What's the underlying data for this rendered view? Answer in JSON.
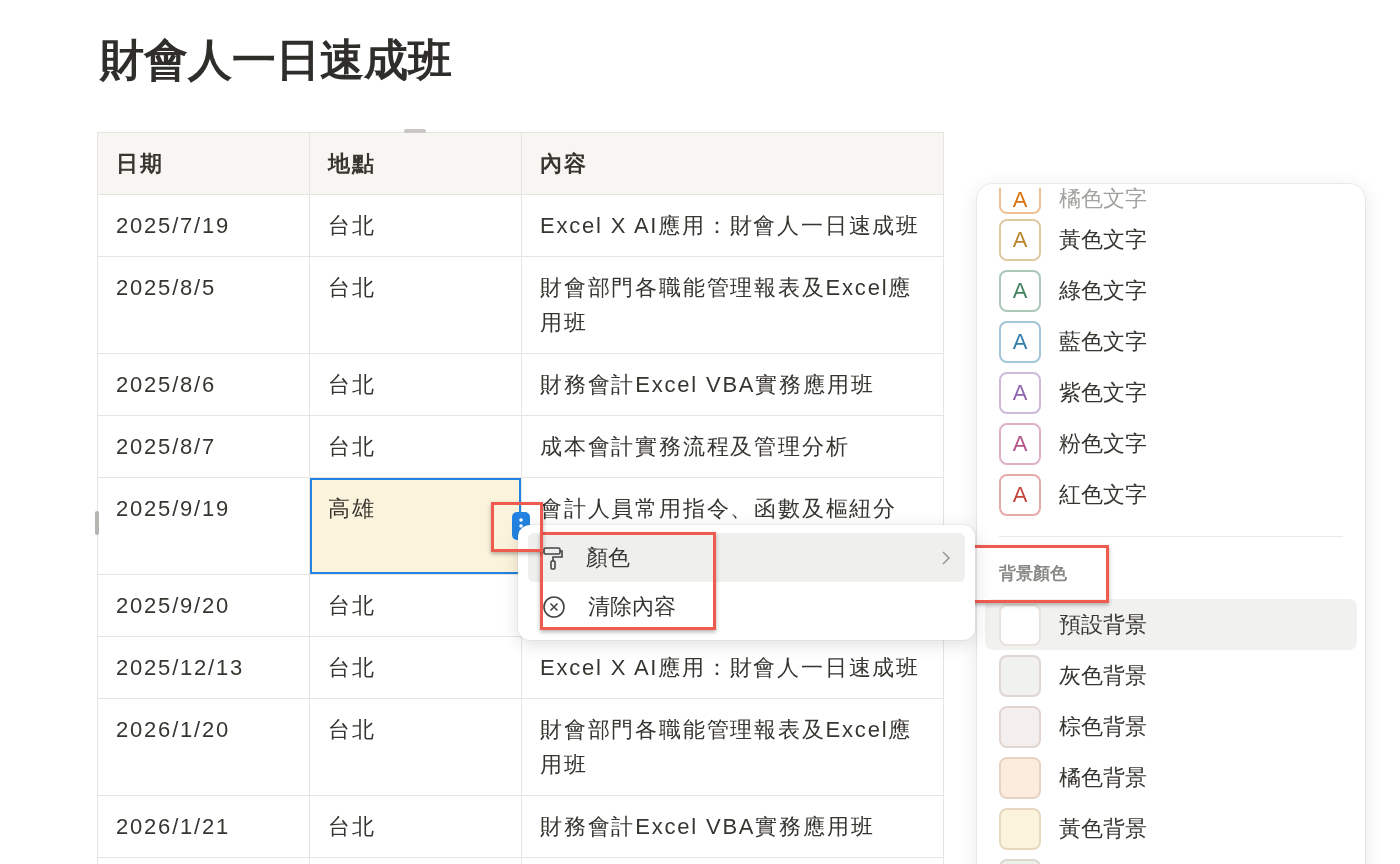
{
  "title": "財會人一日速成班",
  "table": {
    "columns": [
      "日期",
      "地點",
      "內容"
    ],
    "rows": [
      {
        "date": "2025/7/19",
        "place": "台北",
        "content": "Excel X AI應用：財會人一日速成班",
        "selected": false
      },
      {
        "date": "2025/8/5",
        "place": "台北",
        "content": "財會部門各職能管理報表及Excel應用班",
        "selected": false
      },
      {
        "date": "2025/8/6",
        "place": "台北",
        "content": "財務會計Excel VBA實務應用班",
        "selected": false
      },
      {
        "date": "2025/8/7",
        "place": "台北",
        "content": "成本會計實務流程及管理分析",
        "selected": false
      },
      {
        "date": "2025/9/19",
        "place": "高雄",
        "content": "會計人員常用指令、函數及樞紐分",
        "selected": true
      },
      {
        "date": "2025/9/20",
        "place": "台北",
        "selected": false
      },
      {
        "date": "2025/12/13",
        "place": "台北",
        "content": "Excel X AI應用：財會人一日速成班",
        "selected": false
      },
      {
        "date": "2026/1/20",
        "place": "台北",
        "content": "財會部門各職能管理報表及Excel應用班",
        "selected": false
      },
      {
        "date": "2026/1/21",
        "place": "台北",
        "content": "財務會計Excel VBA實務應用班",
        "selected": false
      },
      {
        "selected": false
      }
    ]
  },
  "cell_handle": {
    "highlighted": true
  },
  "cell_menu": {
    "highlighted": true,
    "items": [
      {
        "kind": "submenu",
        "label": "顏色",
        "hovered": true
      },
      {
        "kind": "clear",
        "label": "清除內容",
        "hovered": false
      }
    ]
  },
  "color_panel": {
    "text_colors": [
      {
        "glyph": "A",
        "label": "橘色文字",
        "color": "#d9730d",
        "faded": true
      },
      {
        "glyph": "A",
        "label": "黃色文字",
        "color": "#b8872e",
        "faded": false
      },
      {
        "glyph": "A",
        "label": "綠色文字",
        "color": "#448361",
        "faded": false
      },
      {
        "glyph": "A",
        "label": "藍色文字",
        "color": "#337ea9",
        "faded": false
      },
      {
        "glyph": "A",
        "label": "紫色文字",
        "color": "#9065b0",
        "faded": false
      },
      {
        "glyph": "A",
        "label": "粉色文字",
        "color": "#b35488",
        "faded": false
      },
      {
        "glyph": "A",
        "label": "紅色文字",
        "color": "#c4463f",
        "faded": false
      }
    ],
    "section_header": {
      "label": "背景顏色",
      "highlighted": true
    },
    "background_colors": [
      {
        "label": "預設背景",
        "color": "#ffffff",
        "hovered": true
      },
      {
        "label": "灰色背景",
        "color": "#f1f1ef",
        "hovered": false
      },
      {
        "label": "棕色背景",
        "color": "#f4eeee",
        "hovered": false
      },
      {
        "label": "橘色背景",
        "color": "#fbecdd",
        "hovered": false
      },
      {
        "label": "黃色背景",
        "color": "#fbf3db",
        "hovered": false
      },
      {
        "color": "#edf3ec",
        "hovered": false
      }
    ]
  }
}
